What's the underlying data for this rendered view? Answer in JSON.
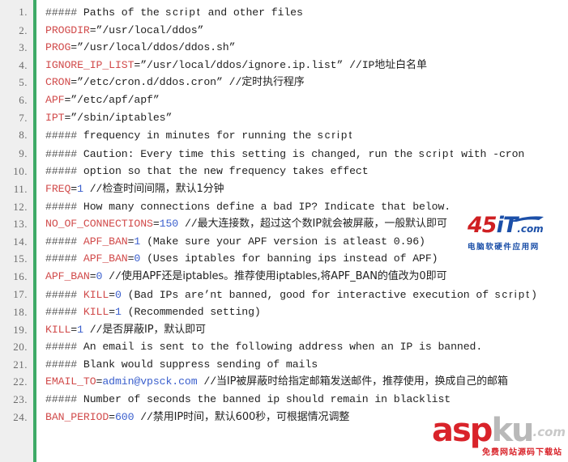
{
  "viewer": {
    "title": "ddos deflate config code listing",
    "gutter_accent_color": "#3eaa67",
    "gutter_background": "#efefef",
    "keyword_color": "#d14b4b",
    "value_color": "#3a5fcd"
  },
  "lines": [
    {
      "no": "1",
      "segments": [
        {
          "t": "#####",
          "c": "hash"
        },
        {
          "t": " Paths of the ",
          "c": "cmt"
        },
        {
          "t": "script",
          "c": "sans"
        },
        {
          "t": " and other files",
          "c": "cmt"
        }
      ]
    },
    {
      "no": "2",
      "segments": [
        {
          "t": "PROGDIR",
          "c": "k"
        },
        {
          "t": "=”/usr/local/ddos”",
          "c": "str"
        }
      ]
    },
    {
      "no": "3",
      "segments": [
        {
          "t": "PROG",
          "c": "k"
        },
        {
          "t": "=”/usr/local/ddos/ddos.sh”",
          "c": "str"
        }
      ]
    },
    {
      "no": "4",
      "segments": [
        {
          "t": "IGNORE_IP_LIST",
          "c": "k"
        },
        {
          "t": "=”/usr/local/ddos/ignore.ip.list” ",
          "c": "str"
        },
        {
          "t": "//IP",
          "c": "cmt"
        },
        {
          "t": "地址白名单",
          "c": "cjk"
        }
      ]
    },
    {
      "no": "5",
      "segments": [
        {
          "t": "CRON",
          "c": "k"
        },
        {
          "t": "=”/etc/cron.d/ddos.cron” ",
          "c": "str"
        },
        {
          "t": "//",
          "c": "cmt"
        },
        {
          "t": "定时执行程序",
          "c": "cjk"
        }
      ]
    },
    {
      "no": "6",
      "segments": [
        {
          "t": "APF",
          "c": "k"
        },
        {
          "t": "=”/etc/apf/apf”",
          "c": "str"
        }
      ]
    },
    {
      "no": "7",
      "segments": [
        {
          "t": "IPT",
          "c": "k"
        },
        {
          "t": "=”/sbin/iptables”",
          "c": "str"
        }
      ]
    },
    {
      "no": "8",
      "segments": [
        {
          "t": "#####",
          "c": "hash"
        },
        {
          "t": " frequency in minutes for running the ",
          "c": "cmt"
        },
        {
          "t": "script",
          "c": "sans"
        }
      ]
    },
    {
      "no": "9",
      "segments": [
        {
          "t": "#####",
          "c": "hash"
        },
        {
          "t": " Caution: Every time this setting is changed, run the ",
          "c": "cmt"
        },
        {
          "t": "script",
          "c": "sans"
        },
        {
          "t": " with -cron",
          "c": "cmt"
        }
      ]
    },
    {
      "no": "10",
      "segments": [
        {
          "t": "#####",
          "c": "hash"
        },
        {
          "t": " option so that the new frequency takes effect",
          "c": "cmt"
        }
      ]
    },
    {
      "no": "11",
      "segments": [
        {
          "t": "FREQ",
          "c": "k"
        },
        {
          "t": "=",
          "c": "cmt"
        },
        {
          "t": "1",
          "c": "num"
        },
        {
          "t": " //",
          "c": "cmt"
        },
        {
          "t": "检查时间间隔，默认1分钟",
          "c": "cjk"
        }
      ]
    },
    {
      "no": "12",
      "segments": [
        {
          "t": "#####",
          "c": "hash"
        },
        {
          "t": " How many connections define a bad IP? Indicate that below.",
          "c": "cmt"
        }
      ]
    },
    {
      "no": "13",
      "segments": [
        {
          "t": "NO_OF_CONNECTIONS",
          "c": "k"
        },
        {
          "t": "=",
          "c": "cmt"
        },
        {
          "t": "150",
          "c": "num"
        },
        {
          "t": " //",
          "c": "cmt"
        },
        {
          "t": "最大连接数，超过这个数IP就会被屏蔽，一般默认即可",
          "c": "cjk"
        }
      ]
    },
    {
      "no": "14",
      "segments": [
        {
          "t": "##### ",
          "c": "hash"
        },
        {
          "t": "APF_BAN",
          "c": "k"
        },
        {
          "t": "=",
          "c": "cmt"
        },
        {
          "t": "1",
          "c": "num"
        },
        {
          "t": " (Make sure your APF version is atleast 0.96)",
          "c": "cmt"
        }
      ]
    },
    {
      "no": "15",
      "segments": [
        {
          "t": "##### ",
          "c": "hash"
        },
        {
          "t": "APF_BAN",
          "c": "k"
        },
        {
          "t": "=",
          "c": "cmt"
        },
        {
          "t": "0",
          "c": "num"
        },
        {
          "t": " (Uses iptables for banning ips instead of APF)",
          "c": "cmt"
        }
      ]
    },
    {
      "no": "16",
      "segments": [
        {
          "t": "APF_BAN",
          "c": "k"
        },
        {
          "t": "=",
          "c": "cmt"
        },
        {
          "t": "0",
          "c": "num"
        },
        {
          "t": " //",
          "c": "cmt"
        },
        {
          "t": "使用APF还是iptables。推荐使用iptables,将APF_BAN的值改为0即可",
          "c": "cjk"
        }
      ]
    },
    {
      "no": "17",
      "segments": [
        {
          "t": "##### ",
          "c": "hash"
        },
        {
          "t": "KILL",
          "c": "k"
        },
        {
          "t": "=",
          "c": "cmt"
        },
        {
          "t": "0",
          "c": "num"
        },
        {
          "t": " (Bad IPs are’nt banned, good for interactive execution of ",
          "c": "cmt"
        },
        {
          "t": "script",
          "c": "sans"
        },
        {
          "t": ")",
          "c": "cmt"
        }
      ]
    },
    {
      "no": "18",
      "segments": [
        {
          "t": "##### ",
          "c": "hash"
        },
        {
          "t": "KILL",
          "c": "k"
        },
        {
          "t": "=",
          "c": "cmt"
        },
        {
          "t": "1",
          "c": "num"
        },
        {
          "t": " (Recommended setting)",
          "c": "cmt"
        }
      ]
    },
    {
      "no": "19",
      "segments": [
        {
          "t": "KILL",
          "c": "k"
        },
        {
          "t": "=",
          "c": "cmt"
        },
        {
          "t": "1",
          "c": "num"
        },
        {
          "t": " //",
          "c": "cmt"
        },
        {
          "t": "是否屏蔽IP，默认即可",
          "c": "cjk"
        }
      ]
    },
    {
      "no": "20",
      "segments": [
        {
          "t": "#####",
          "c": "hash"
        },
        {
          "t": " An email is sent to the following address when an IP is banned.",
          "c": "cmt"
        }
      ]
    },
    {
      "no": "21",
      "segments": [
        {
          "t": "#####",
          "c": "hash"
        },
        {
          "t": " Blank would suppress sending of mails",
          "c": "cmt"
        }
      ]
    },
    {
      "no": "22",
      "segments": [
        {
          "t": "EMAIL_TO",
          "c": "k"
        },
        {
          "t": "=",
          "c": "cmt"
        },
        {
          "t": "admin@vpsck.com",
          "c": "num"
        },
        {
          "t": " //",
          "c": "cmt"
        },
        {
          "t": "当IP被屏蔽时给指定邮箱发送邮件，推荐使用，换成自己的邮箱",
          "c": "cjk"
        }
      ]
    },
    {
      "no": "23",
      "segments": [
        {
          "t": "#####",
          "c": "hash"
        },
        {
          "t": " Number of seconds the banned ip should remain in blacklist",
          "c": "cmt"
        }
      ]
    },
    {
      "no": "24",
      "segments": [
        {
          "t": "BAN_PERIOD",
          "c": "k"
        },
        {
          "t": "=",
          "c": "cmt"
        },
        {
          "t": "600",
          "c": "num"
        },
        {
          "t": " //",
          "c": "cmt"
        },
        {
          "t": "禁用IP时间，默认600秒，可根据情况调整",
          "c": "cjk"
        }
      ]
    }
  ],
  "watermarks": {
    "site45it": {
      "digits": "45",
      "letters": "iT",
      "domain": ".com",
      "subtitle": "电脑软硬件应用网",
      "color_blue": "#1b4fa8",
      "color_red": "#cf1f22"
    },
    "aspku": {
      "asp": "asp",
      "ku": "ku",
      "domain": ".com",
      "subtitle": "免费网站源码下载站",
      "color_red": "#d9232a",
      "color_gray": "#b9b9b9"
    }
  }
}
